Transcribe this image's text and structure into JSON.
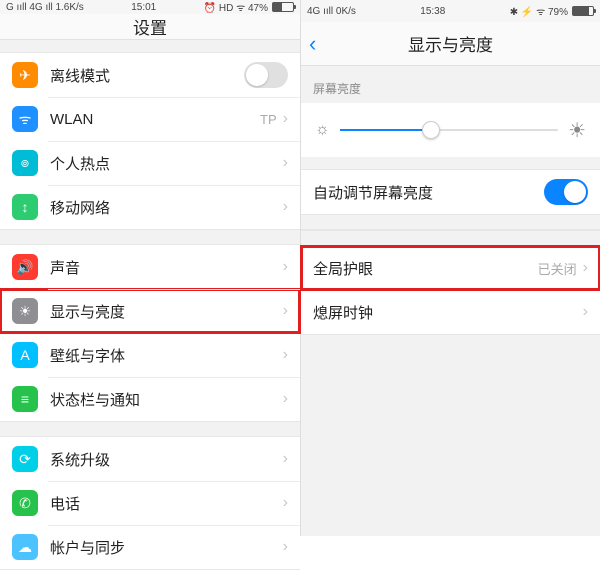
{
  "left": {
    "status": {
      "network": "G ııll 4G ıll 1.6K/s",
      "time": "15:01",
      "right": "⏰ HD ᯤ 47%",
      "battery_pct": 47
    },
    "title": "设置",
    "groups": [
      [
        {
          "icon": "airplane-icon",
          "color": "ic-orange",
          "glyph": "✈",
          "label": "离线模式",
          "control": "toggle-off"
        },
        {
          "icon": "wifi-icon",
          "color": "ic-blue",
          "glyph": "ᯤ",
          "label": "WLAN",
          "meta": "TP",
          "control": "chevron"
        },
        {
          "icon": "hotspot-icon",
          "color": "ic-teal",
          "glyph": "๏",
          "label": "个人热点",
          "control": "chevron"
        },
        {
          "icon": "cellular-icon",
          "color": "ic-green",
          "glyph": "↕",
          "label": "移动网络",
          "control": "chevron"
        }
      ],
      [
        {
          "icon": "sound-icon",
          "color": "ic-red",
          "glyph": "🔊",
          "label": "声音",
          "control": "chevron"
        },
        {
          "icon": "display-icon",
          "color": "ic-gray",
          "glyph": "☀",
          "label": "显示与亮度",
          "control": "chevron",
          "highlight": true
        },
        {
          "icon": "wallpaper-icon",
          "color": "ic-aqua",
          "glyph": "A",
          "label": "壁纸与字体",
          "control": "chevron"
        },
        {
          "icon": "notifications-icon",
          "color": "ic-green2",
          "glyph": "≡",
          "label": "状态栏与通知",
          "control": "chevron"
        }
      ],
      [
        {
          "icon": "update-icon",
          "color": "ic-cyan",
          "glyph": "⟳",
          "label": "系统升级",
          "control": "chevron"
        },
        {
          "icon": "phone-icon",
          "color": "ic-green2",
          "glyph": "✆",
          "label": "电话",
          "control": "chevron"
        },
        {
          "icon": "account-icon",
          "color": "ic-sky",
          "glyph": "☁",
          "label": "帐户与同步",
          "control": "chevron"
        }
      ]
    ]
  },
  "right": {
    "status": {
      "network": "4G ııll 0K/s",
      "time": "15:38",
      "right": "✱ ⚡ ᯤ 79%",
      "battery_pct": 79
    },
    "title": "显示与亮度",
    "brightness_label": "屏幕亮度",
    "brightness_pct": 42,
    "rows": [
      {
        "label": "自动调节屏幕亮度",
        "control": "toggle-on"
      },
      {
        "label": "全局护眼",
        "meta": "已关闭",
        "control": "chevron",
        "highlight": true
      },
      {
        "label": "熄屏时钟",
        "control": "chevron"
      }
    ]
  },
  "chevron_glyph": "›"
}
